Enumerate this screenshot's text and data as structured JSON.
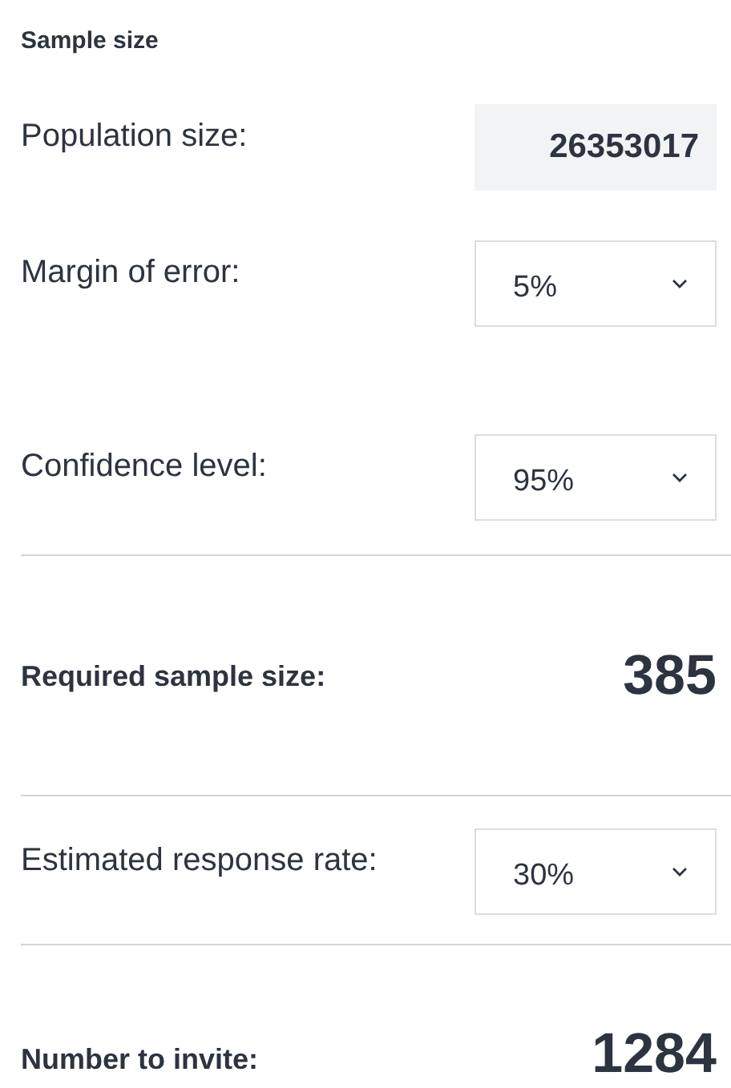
{
  "title": "Sample size",
  "rows": [
    {
      "kind": "field",
      "label": "Population size:",
      "value": "26353017"
    },
    {
      "kind": "select",
      "label": "Margin of error:",
      "value": "5%"
    },
    {
      "kind": "select",
      "label": "Confidence level:",
      "value": "95%"
    },
    {
      "kind": "result",
      "label": "Required sample size:",
      "value": "385"
    },
    {
      "kind": "select",
      "label": "Estimated response rate:",
      "value": "30%"
    },
    {
      "kind": "result",
      "label": "Number to invite:",
      "value": "1284"
    }
  ]
}
